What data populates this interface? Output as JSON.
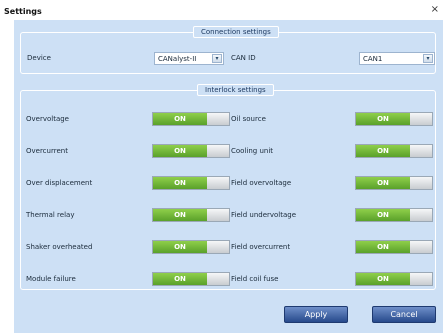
{
  "window": {
    "title": "Settings",
    "close_glyph": "×"
  },
  "connection": {
    "legend": "Connection settings",
    "device_label": "Device",
    "device_value": "CANalyst-II",
    "can_id_label": "CAN ID",
    "can_id_value": "CAN1",
    "dropdown_glyph": "▾"
  },
  "interlock": {
    "legend": "Interlock settings",
    "left": [
      {
        "label": "Overvoltage",
        "state": "ON"
      },
      {
        "label": "Overcurrent",
        "state": "ON"
      },
      {
        "label": "Over displacement",
        "state": "ON"
      },
      {
        "label": "Thermal relay",
        "state": "ON"
      },
      {
        "label": "Shaker overheated",
        "state": "ON"
      },
      {
        "label": "Module failure",
        "state": "ON"
      }
    ],
    "right": [
      {
        "label": "Oil source",
        "state": "ON"
      },
      {
        "label": "Cooling unit",
        "state": "ON"
      },
      {
        "label": "Field overvoltage",
        "state": "ON"
      },
      {
        "label": "Field undervoltage",
        "state": "ON"
      },
      {
        "label": "Field overcurrent",
        "state": "ON"
      },
      {
        "label": "Field coil fuse",
        "state": "ON"
      }
    ]
  },
  "buttons": {
    "apply": "Apply",
    "cancel": "Cancel"
  },
  "colors": {
    "panel_bg": "#cde0f5",
    "toggle_on": "#6fb836",
    "button": "#274a8c"
  }
}
